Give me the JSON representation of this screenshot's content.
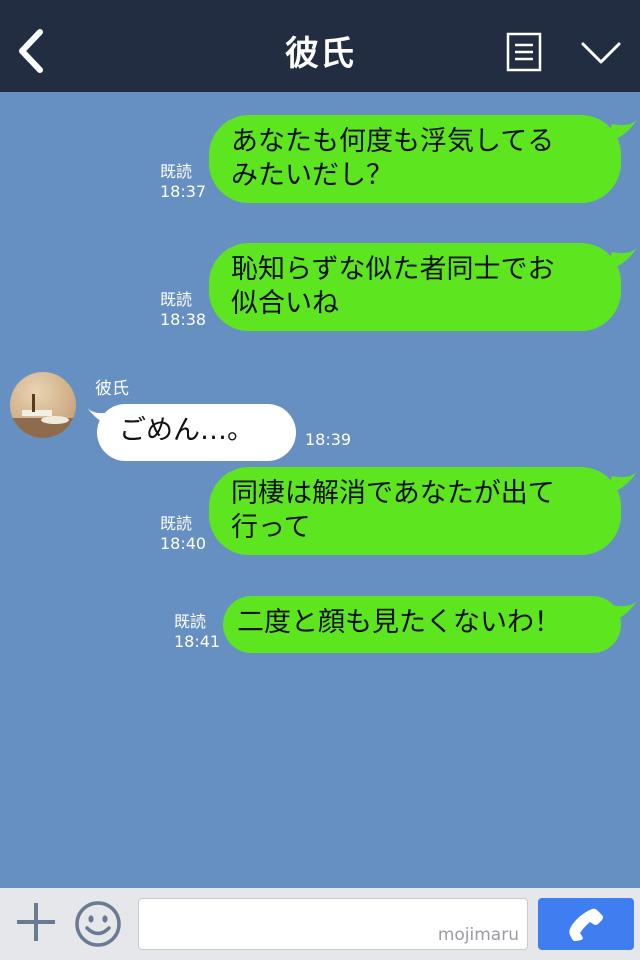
{
  "header": {
    "title": "彼氏"
  },
  "messages": [
    {
      "side": "out",
      "text": "あなたも何度も浮気してる\nみたいだし？",
      "read_label": "既読",
      "time": "18:37"
    },
    {
      "side": "out",
      "text": "恥知らずな似た者同士でお\n似合いね",
      "read_label": "既読",
      "time": "18:38"
    },
    {
      "side": "in",
      "sender": "彼氏",
      "text": "ごめん…。",
      "time": "18:39"
    },
    {
      "side": "out",
      "text": "同棲は解消であなたが出て\n行って",
      "read_label": "既読",
      "time": "18:40"
    },
    {
      "side": "out",
      "text": "二度と顔も見たくないわ！",
      "read_label": "既読",
      "time": "18:41"
    }
  ],
  "footer": {
    "watermark": "mojimaru"
  },
  "colors": {
    "header_bg": "#232d42",
    "chat_bg": "#6790c2",
    "outgoing_bubble": "#5de61f",
    "incoming_bubble": "#ffffff",
    "call_button": "#3e7ef0"
  }
}
